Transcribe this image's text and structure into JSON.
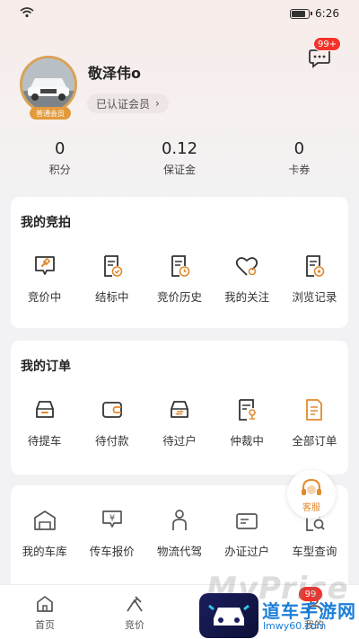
{
  "status_bar": {
    "time": "6:26"
  },
  "profile": {
    "name": "敬泽伟o",
    "vip_badge": "普通会员",
    "member_label": "已认证会员",
    "member_chevron": "›",
    "message_badge": "99+"
  },
  "stats": [
    {
      "value": "0",
      "label": "积分"
    },
    {
      "value": "0.12",
      "label": "保证金"
    },
    {
      "value": "0",
      "label": "卡券"
    }
  ],
  "bidding": {
    "title": "我的竞拍",
    "items": [
      {
        "label": "竞价中",
        "icon": "auction-hammer-icon"
      },
      {
        "label": "结标中",
        "icon": "document-check-icon"
      },
      {
        "label": "竞价历史",
        "icon": "history-document-icon"
      },
      {
        "label": "我的关注",
        "icon": "heart-icon"
      },
      {
        "label": "浏览记录",
        "icon": "browse-record-icon"
      }
    ]
  },
  "orders": {
    "title": "我的订单",
    "items": [
      {
        "label": "待提车",
        "icon": "car-pickup-icon"
      },
      {
        "label": "待付款",
        "icon": "wallet-icon"
      },
      {
        "label": "待过户",
        "icon": "car-transfer-icon"
      },
      {
        "label": "仲裁中",
        "icon": "arbitration-icon"
      },
      {
        "label": "全部订单",
        "icon": "all-orders-icon"
      }
    ]
  },
  "services": {
    "items": [
      {
        "label": "我的车库",
        "icon": "garage-icon"
      },
      {
        "label": "传车报价",
        "icon": "price-quote-icon"
      },
      {
        "label": "物流代驾",
        "icon": "logistics-icon"
      },
      {
        "label": "办证过户",
        "icon": "certificate-icon"
      },
      {
        "label": "车型查询",
        "icon": "model-search-icon"
      }
    ]
  },
  "customer_service": {
    "label": "客服"
  },
  "bottom_nav": {
    "items": [
      {
        "label": "首页",
        "icon": "home-icon"
      },
      {
        "label": "竞价",
        "icon": "bid-icon"
      },
      {
        "label": "",
        "icon": "center-icon"
      },
      {
        "label": "我的",
        "icon": "profile-icon"
      }
    ],
    "badge": "99"
  },
  "watermark": {
    "latin": "MyPrice",
    "chinese": "道车手游网",
    "url": "lmwy60.com"
  },
  "colors": {
    "accent": "#e08a2e",
    "badge_red": "#f2332b",
    "card_bg": "#ffffff",
    "page_bg": "#f2f2f4"
  }
}
